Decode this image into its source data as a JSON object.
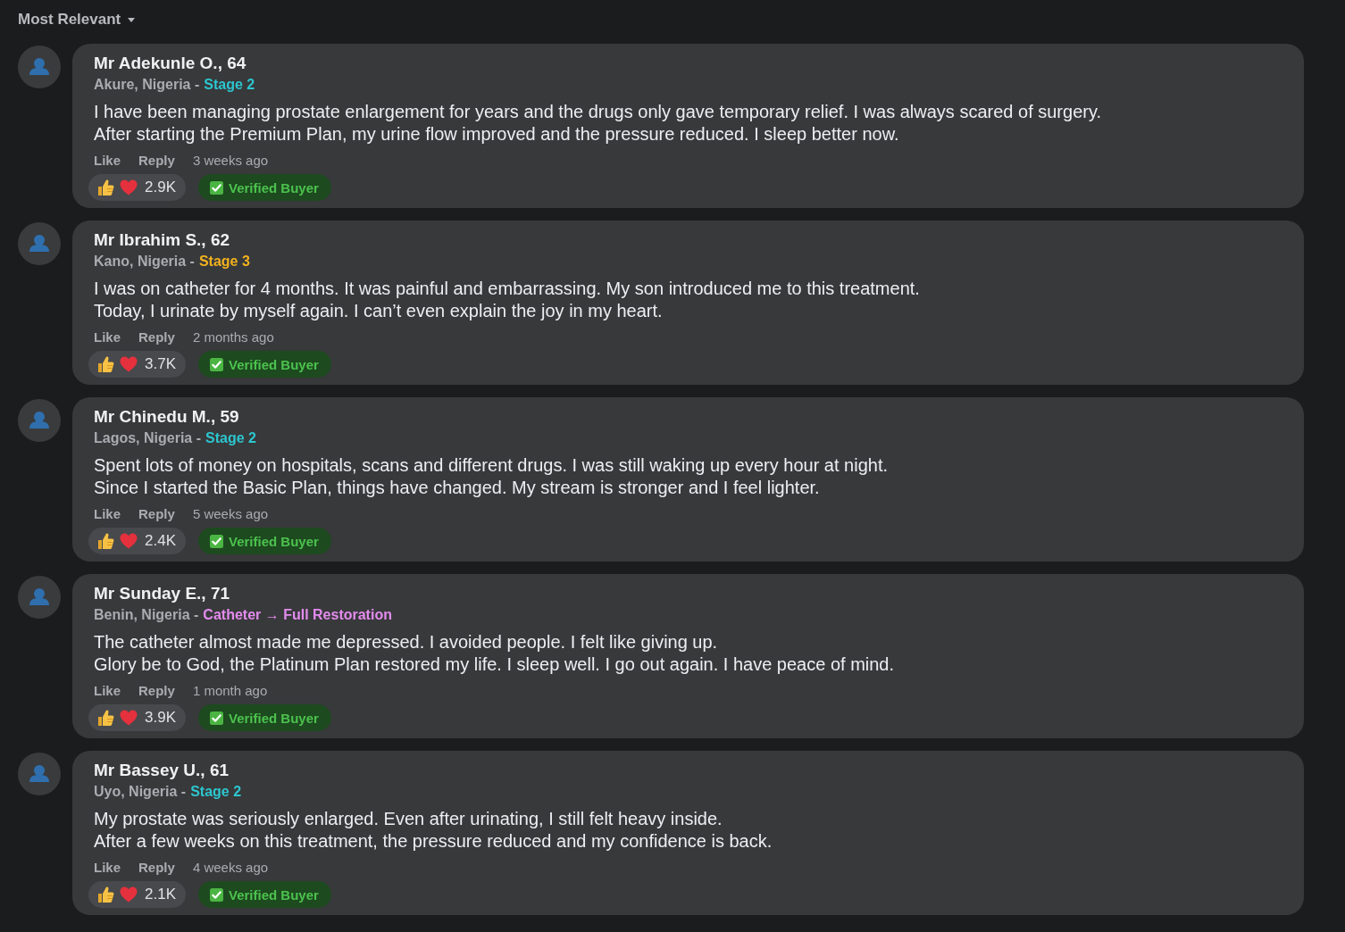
{
  "sort_menu": {
    "label": "Most Relevant"
  },
  "comments": [
    {
      "name": "Mr Adekunle O., 64",
      "location": "Akure, Nigeria -",
      "stage": {
        "label": "Stage 2",
        "color": "#2cc6cf"
      },
      "lines": [
        "I have been managing prostate enlargement for years and the drugs only gave temporary relief. I was always scared of surgery.",
        "After starting the Premium Plan, my urine flow improved and the pressure reduced. I sleep better now."
      ],
      "like_label": "Like",
      "reply_label": "Reply",
      "time": "3 weeks ago",
      "reaction_count": "2.9K",
      "badge": "Verified Buyer"
    },
    {
      "name": "Mr Ibrahim S., 62",
      "location": "Kano, Nigeria -",
      "stage": {
        "label": "Stage 3",
        "color": "#f2b21e"
      },
      "lines": [
        "I was on catheter for 4 months. It was painful and embarrassing. My son introduced me to this treatment.",
        "Today, I urinate by myself again. I can’t even explain the joy in my heart."
      ],
      "like_label": "Like",
      "reply_label": "Reply",
      "time": "2 months ago",
      "reaction_count": "3.7K",
      "badge": "Verified Buyer"
    },
    {
      "name": "Mr Chinedu M., 59",
      "location": "Lagos, Nigeria -",
      "stage": {
        "label": "Stage 2",
        "color": "#2cc6cf"
      },
      "lines": [
        "Spent lots of money on hospitals, scans and different drugs. I was still waking up every hour at night.",
        "Since I started the Basic Plan, things have changed. My stream is stronger and I feel lighter."
      ],
      "like_label": "Like",
      "reply_label": "Reply",
      "time": "5 weeks ago",
      "reaction_count": "2.4K",
      "badge": "Verified Buyer"
    },
    {
      "name": "Mr Sunday E., 71",
      "location": "Benin, Nigeria -",
      "stage": {
        "label": "Catheter → Full Restoration",
        "color": "#e48cee"
      },
      "lines": [
        "The catheter almost made me depressed. I avoided people. I felt like giving up.",
        "Glory be to God, the Platinum Plan restored my life. I sleep well. I go out again. I have peace of mind."
      ],
      "like_label": "Like",
      "reply_label": "Reply",
      "time": "1 month ago",
      "reaction_count": "3.9K",
      "badge": "Verified Buyer"
    },
    {
      "name": "Mr Bassey U., 61",
      "location": "Uyo, Nigeria -",
      "stage": {
        "label": "Stage 2",
        "color": "#2cc6cf"
      },
      "lines": [
        "My prostate was seriously enlarged. Even after urinating, I still felt heavy inside.",
        "After a few weeks on this treatment, the pressure reduced and my confidence is back."
      ],
      "like_label": "Like",
      "reply_label": "Reply",
      "time": "4 weeks ago",
      "reaction_count": "2.1K",
      "badge": "Verified Buyer"
    }
  ]
}
